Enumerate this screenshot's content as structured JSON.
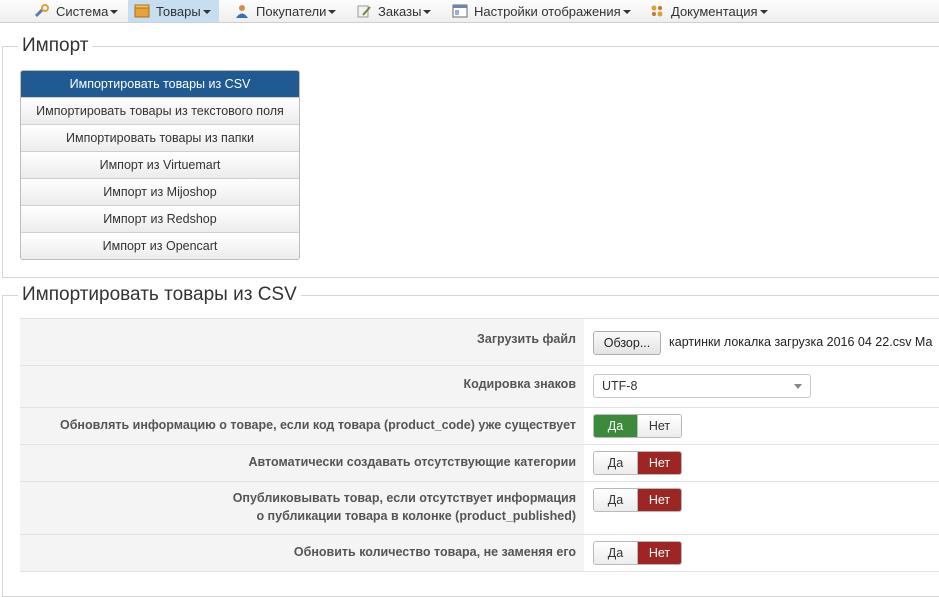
{
  "nav": [
    {
      "label": "Система",
      "icon": "wrench-icon"
    },
    {
      "label": "Товары",
      "icon": "box-icon"
    },
    {
      "label": "Покупатели",
      "icon": "user-icon"
    },
    {
      "label": "Заказы",
      "icon": "pencil-paper-icon"
    },
    {
      "label": "Настройки отображения",
      "icon": "window-icon"
    },
    {
      "label": "Документация",
      "icon": "gear-cluster-icon"
    }
  ],
  "import_section": {
    "title": "Импорт",
    "items": [
      "Импортировать товары из CSV",
      "Импортировать товары из текстового поля",
      "Импортировать товары из папки",
      "Импорт из Virtuemart",
      "Импорт из Mijoshop",
      "Импорт из Redshop",
      "Импорт из Opencart"
    ]
  },
  "csv_section": {
    "title": "Импортировать товары из CSV",
    "upload_label": "Загрузить файл",
    "browse_label": "Обзор...",
    "file_name": "картинки локалка загрузка 2016 04 22.csv Ма",
    "encoding_label": "Кодировка знаков",
    "encoding_value": "UTF-8",
    "update_label": "Обновлять информацию о товаре, если код товара (product_code) уже существует",
    "autocat_label": "Автоматически создавать отсутствующие категории",
    "publish_label_1": "Опубликовывать товар, если отсутствует информация",
    "publish_label_2": "о публикации товара в колонке (product_published)",
    "qty_label": "Обновить количество товара, не заменяя его",
    "yes": "Да",
    "no": "Нет"
  },
  "colors": {
    "accent": "#1f5a93",
    "yes_active": "#3c8a3c",
    "no_active": "#9d2624"
  }
}
